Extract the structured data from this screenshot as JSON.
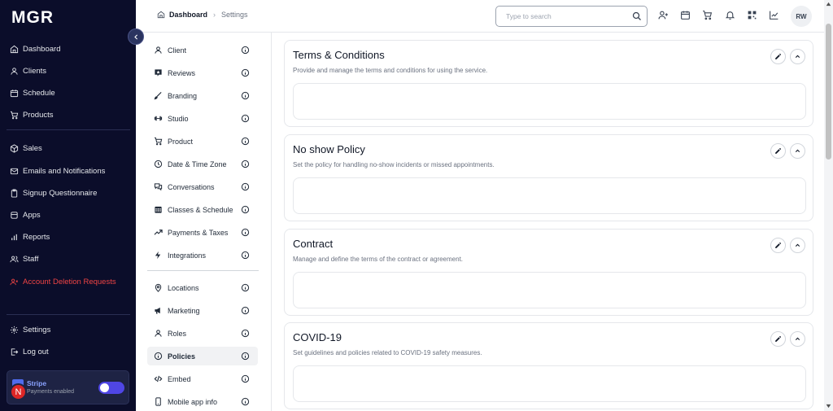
{
  "app": {
    "logo": "MGR"
  },
  "sidebar": {
    "items": [
      {
        "label": "Dashboard",
        "icon": "home-icon"
      },
      {
        "label": "Clients",
        "icon": "user-icon"
      },
      {
        "label": "Schedule",
        "icon": "calendar-icon"
      },
      {
        "label": "Products",
        "icon": "cart-icon"
      },
      {
        "label": "Sales",
        "icon": "box-icon"
      },
      {
        "label": "Emails and Notifications",
        "icon": "mail-icon"
      },
      {
        "label": "Signup Questionnaire",
        "icon": "clipboard-icon"
      },
      {
        "label": "Apps",
        "icon": "apps-icon"
      },
      {
        "label": "Reports",
        "icon": "bar-chart-icon"
      },
      {
        "label": "Staff",
        "icon": "users-icon"
      },
      {
        "label": "Account Deletion Requests",
        "icon": "user-x-icon"
      },
      {
        "label": "Settings",
        "icon": "gear-icon"
      },
      {
        "label": "Log out",
        "icon": "logout-icon"
      }
    ],
    "stripe": {
      "name": "Stripe",
      "status": "Payments enabled",
      "enabled": true
    },
    "notification_badge": "N",
    "colors": {
      "background": "#0b0d2a",
      "danger": "#ef4444",
      "accent": "#4f46e5"
    }
  },
  "header": {
    "breadcrumb": {
      "root": "Dashboard",
      "separator": "›",
      "current": "Settings"
    },
    "search": {
      "placeholder": "Type to search",
      "value": ""
    },
    "icons": [
      "user-plus-icon",
      "calendar-icon",
      "cart-icon",
      "bell-icon",
      "qr-code-icon",
      "trend-chart-icon"
    ],
    "avatar": "RW"
  },
  "settings_nav": {
    "items": [
      {
        "label": "Client",
        "icon": "user-icon"
      },
      {
        "label": "Reviews",
        "icon": "review-icon"
      },
      {
        "label": "Branding",
        "icon": "brush-icon"
      },
      {
        "label": "Studio",
        "icon": "dumbbell-icon"
      },
      {
        "label": "Product",
        "icon": "cart-icon"
      },
      {
        "label": "Date & Time Zone",
        "icon": "clock-icon"
      },
      {
        "label": "Conversations",
        "icon": "chat-icon"
      },
      {
        "label": "Classes & Schedule",
        "icon": "calendar-grid-icon"
      },
      {
        "label": "Payments & Taxes",
        "icon": "trend-up-icon"
      },
      {
        "label": "Integrations",
        "icon": "plug-icon"
      },
      {
        "label": "Locations",
        "icon": "map-pin-icon"
      },
      {
        "label": "Marketing",
        "icon": "megaphone-icon"
      },
      {
        "label": "Roles",
        "icon": "user-icon"
      },
      {
        "label": "Policies",
        "icon": "info-circle-icon",
        "active": true
      },
      {
        "label": "Embed",
        "icon": "code-icon"
      },
      {
        "label": "Mobile app info",
        "icon": "phone-icon"
      }
    ]
  },
  "main": {
    "cards": [
      {
        "title": "Terms & Conditions",
        "description": "Provide and manage the terms and conditions for using the service."
      },
      {
        "title": "No show Policy",
        "description": "Set the policy for handling no-show incidents or missed appointments."
      },
      {
        "title": "Contract",
        "description": "Manage and define the terms of the contract or agreement."
      },
      {
        "title": "COVID-19",
        "description": "Set guidelines and policies related to COVID-19 safety measures."
      }
    ]
  }
}
